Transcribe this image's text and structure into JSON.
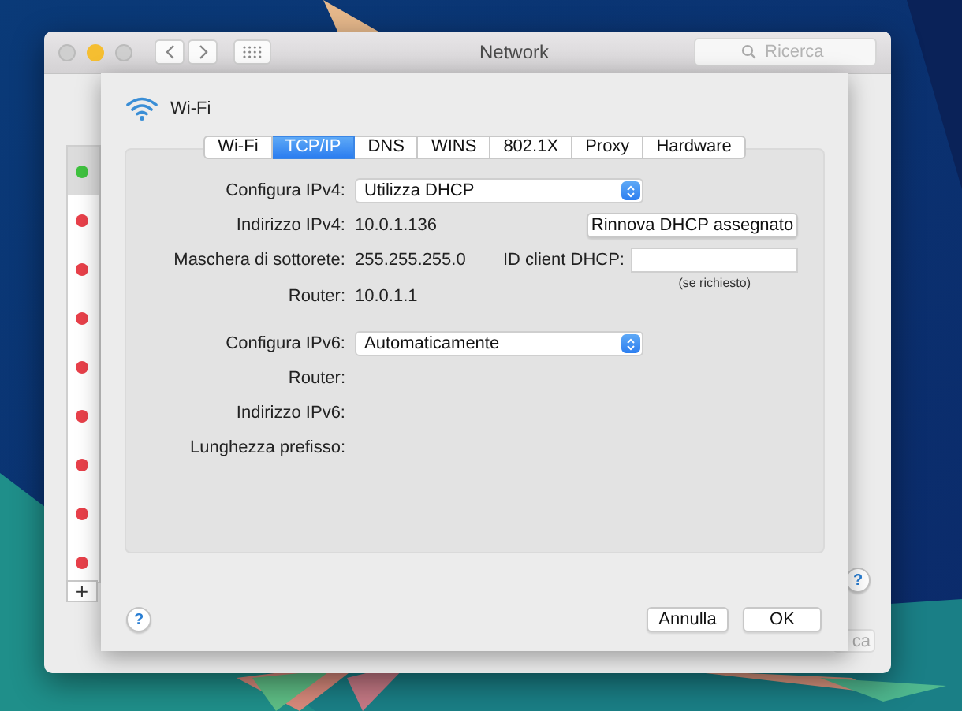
{
  "window": {
    "title": "Network",
    "search": {
      "placeholder": "Ricerca"
    }
  },
  "services": [
    {
      "color": "#3fc23f",
      "selected": true
    },
    {
      "color": "#e8404a",
      "selected": false
    },
    {
      "color": "#e8404a",
      "selected": false
    },
    {
      "color": "#e8404a",
      "selected": false
    },
    {
      "color": "#e8404a",
      "selected": false
    },
    {
      "color": "#e8404a",
      "selected": false
    },
    {
      "color": "#e8404a",
      "selected": false
    },
    {
      "color": "#e8404a",
      "selected": false
    },
    {
      "color": "#e8404a",
      "selected": false
    }
  ],
  "add_button": "+",
  "help_button": "?",
  "partial_button": "ca",
  "sheet": {
    "interface": "Wi-Fi",
    "tabs": [
      {
        "label": "Wi-Fi",
        "selected": false
      },
      {
        "label": "TCP/IP",
        "selected": true
      },
      {
        "label": "DNS",
        "selected": false
      },
      {
        "label": "WINS",
        "selected": false
      },
      {
        "label": "802.1X",
        "selected": false
      },
      {
        "label": "Proxy",
        "selected": false
      },
      {
        "label": "Hardware",
        "selected": false
      }
    ],
    "ipv4": {
      "configure_label": "Configura IPv4:",
      "configure_value": "Utilizza DHCP",
      "address_label": "Indirizzo IPv4:",
      "address": "10.0.1.136",
      "renew_button": "Rinnova DHCP assegnato",
      "subnet_label": "Maschera di sottorete:",
      "subnet": "255.255.255.0",
      "client_id_label": "ID client DHCP:",
      "client_id_hint": "(se richiesto)",
      "router_label": "Router:",
      "router": "10.0.1.1"
    },
    "ipv6": {
      "configure_label": "Configura IPv6:",
      "configure_value": "Automaticamente",
      "router_label": "Router:",
      "address_label": "Indirizzo IPv6:",
      "prefix_label": "Lunghezza prefisso:"
    },
    "help_button": "?",
    "buttons": [
      "Annulla",
      "OK"
    ]
  }
}
